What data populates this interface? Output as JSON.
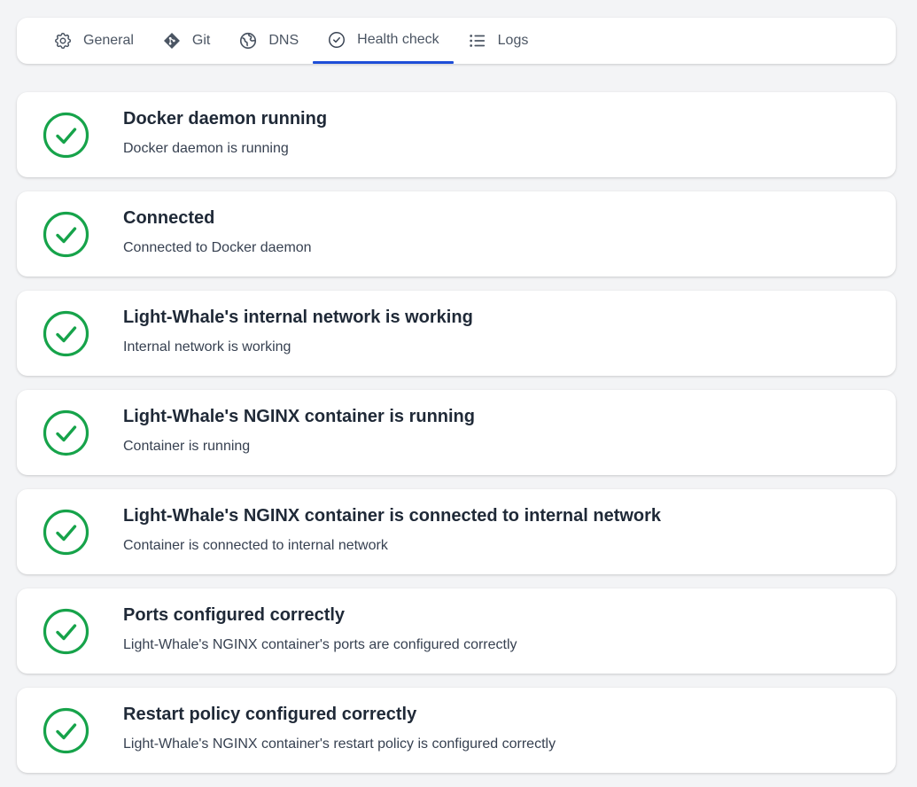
{
  "tabs": [
    {
      "label": "General",
      "icon": "gear-icon"
    },
    {
      "label": "Git",
      "icon": "git-icon"
    },
    {
      "label": "DNS",
      "icon": "globe-icon"
    },
    {
      "label": "Health check",
      "icon": "check-circle-icon",
      "active": true
    },
    {
      "label": "Logs",
      "icon": "list-icon"
    }
  ],
  "colors": {
    "accent": "#1d4ed8",
    "success": "#16a34a"
  },
  "checks": [
    {
      "title": "Docker daemon running",
      "description": "Docker daemon is running",
      "status": "ok"
    },
    {
      "title": "Connected",
      "description": "Connected to Docker daemon",
      "status": "ok"
    },
    {
      "title": "Light-Whale's internal network is working",
      "description": "Internal network is working",
      "status": "ok"
    },
    {
      "title": "Light-Whale's NGINX container is running",
      "description": "Container is running",
      "status": "ok"
    },
    {
      "title": "Light-Whale's NGINX container is connected to internal network",
      "description": "Container is connected to internal network",
      "status": "ok"
    },
    {
      "title": "Ports configured correctly",
      "description": "Light-Whale's NGINX container's ports are configured correctly",
      "status": "ok"
    },
    {
      "title": "Restart policy configured correctly",
      "description": "Light-Whale's NGINX container's restart policy is configured correctly",
      "status": "ok"
    }
  ]
}
